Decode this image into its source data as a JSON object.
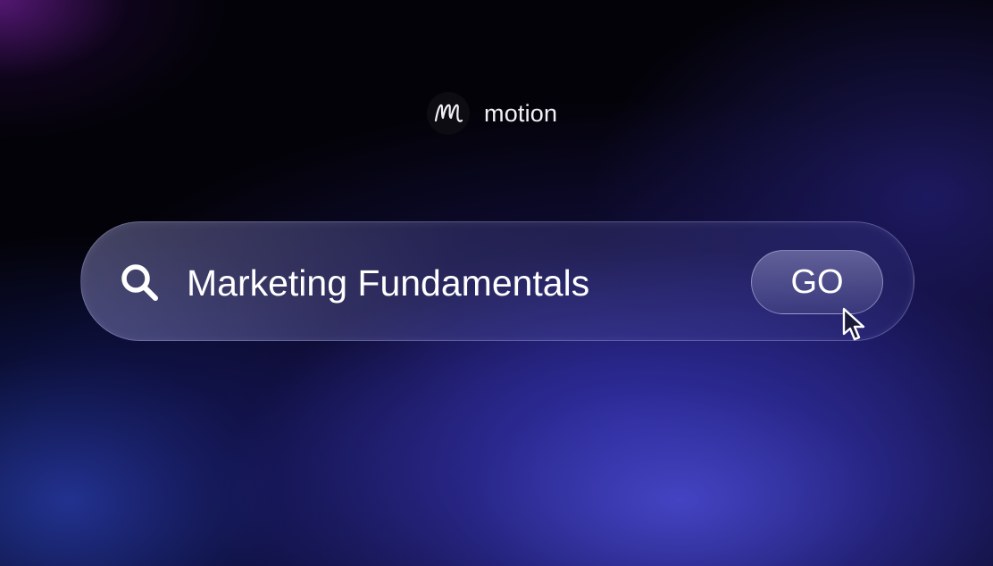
{
  "brand": {
    "name": "motion",
    "logo_icon": "motion-m-logo-icon"
  },
  "search": {
    "query": "Marketing Fundamentals",
    "icon": "search-icon",
    "button_label": "GO"
  },
  "cursor": {
    "icon": "arrow-cursor-icon"
  },
  "colors": {
    "text": "#ffffff",
    "background_dark": "#030208",
    "glow_blue": "#4646c8",
    "glow_purple": "#6e1e96"
  }
}
